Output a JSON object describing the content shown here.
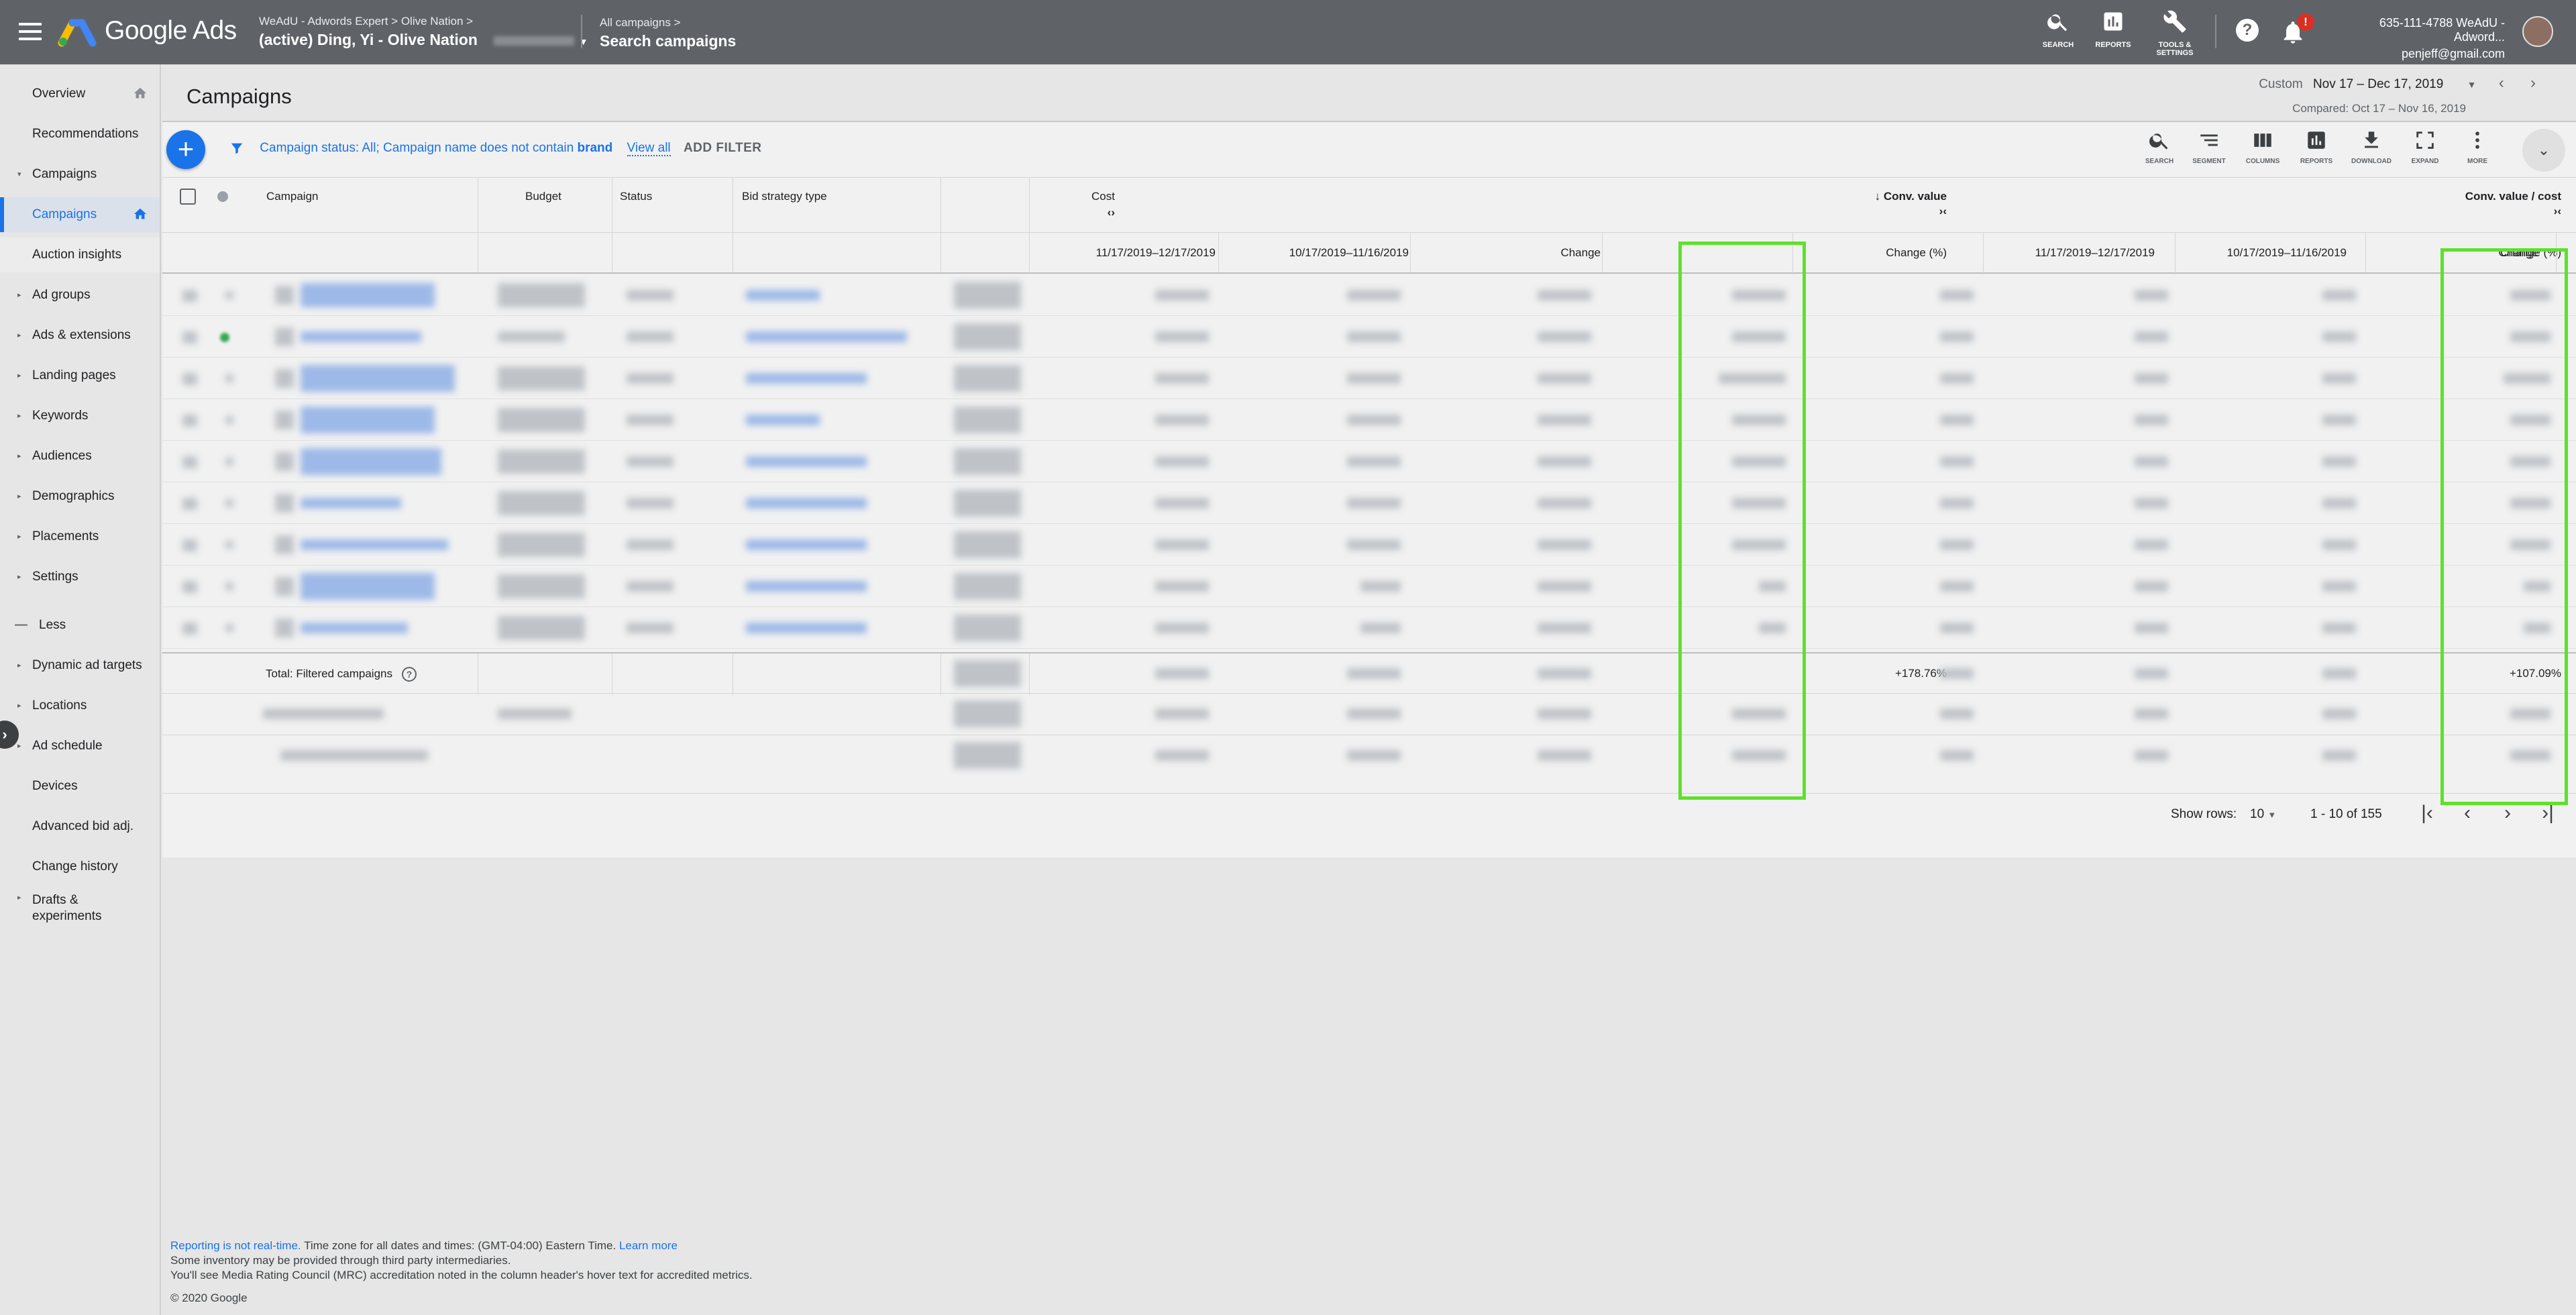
{
  "topbar": {
    "product": "Google Ads",
    "breadcrumb_l1": [
      "WeAdU - Adwords Expert",
      "Olive Nation"
    ],
    "account_name": "(active) Ding, Yi - Olive Nation",
    "campaign_l1": "All campaigns",
    "campaign_l2": "Search campaigns",
    "tools": [
      {
        "label": "SEARCH",
        "icon": "search-icon"
      },
      {
        "label": "REPORTS",
        "icon": "reports-icon"
      },
      {
        "label": "TOOLS & SETTINGS",
        "icon": "wrench-icon"
      }
    ],
    "notification_count": "!",
    "user_line1": "635-111-4788 WeAdU - Adword...",
    "user_line2": "penjeff@gmail.com",
    "help": "?"
  },
  "sidebar": {
    "items": [
      {
        "label": "Overview",
        "arrow": "",
        "home": true
      },
      {
        "label": "Recommendations",
        "arrow": ""
      },
      {
        "label": "Campaigns",
        "arrow": "▾"
      },
      {
        "label": "Campaigns",
        "arrow": "",
        "active": true,
        "home": true
      },
      {
        "label": "Auction insights",
        "arrow": "",
        "sub": true
      },
      {
        "label": "Ad groups",
        "arrow": "▸"
      },
      {
        "label": "Ads & extensions",
        "arrow": "▸"
      },
      {
        "label": "Landing pages",
        "arrow": "▸"
      },
      {
        "label": "Keywords",
        "arrow": "▸"
      },
      {
        "label": "Audiences",
        "arrow": "▸"
      },
      {
        "label": "Demographics",
        "arrow": "▸"
      },
      {
        "label": "Placements",
        "arrow": "▸"
      },
      {
        "label": "Settings",
        "arrow": "▸"
      },
      {
        "label": "Less",
        "arrow": "—"
      },
      {
        "label": "Dynamic ad targets",
        "arrow": "▸"
      },
      {
        "label": "Locations",
        "arrow": "▸"
      },
      {
        "label": "Ad schedule",
        "arrow": "▸"
      },
      {
        "label": "Devices",
        "arrow": ""
      },
      {
        "label": "Advanced bid adj.",
        "arrow": ""
      },
      {
        "label": "Change history",
        "arrow": ""
      },
      {
        "label": "Drafts &",
        "arrow": "▸"
      },
      {
        "label": "experiments",
        "arrow": ""
      }
    ]
  },
  "page": {
    "title": "Campaigns",
    "date_label": "Custom",
    "date_range": "Nov 17 – Dec 17, 2019",
    "compared": "Compared: Oct 17 – Nov 16, 2019"
  },
  "filter": {
    "status_text": "Campaign status: All;",
    "name_text": "Campaign name does not contain",
    "name_value": "brand",
    "view_all": "View all",
    "add_filter": "ADD FILTER"
  },
  "toolbar": [
    {
      "label": "SEARCH",
      "icon": "search-icon"
    },
    {
      "label": "SEGMENT",
      "icon": "segment-icon"
    },
    {
      "label": "COLUMNS",
      "icon": "columns-icon"
    },
    {
      "label": "REPORTS",
      "icon": "reports-icon"
    },
    {
      "label": "DOWNLOAD",
      "icon": "download-icon"
    },
    {
      "label": "EXPAND",
      "icon": "expand-icon"
    },
    {
      "label": "MORE",
      "icon": "more-icon"
    }
  ],
  "table": {
    "headers": {
      "campaign": "Campaign",
      "budget": "Budget",
      "status": "Status",
      "bid_strategy": "Bid strategy type",
      "cost": "Cost",
      "conv_value": "Conv. value",
      "conv_value_cost": "Conv. value / cost"
    },
    "subheaders": [
      "11/17/2019–12/17/2019",
      "10/17/2019–11/16/2019",
      "Change",
      "Change (%)",
      "11/17/2019–12/17/2019",
      "10/17/2019–11/16/2019",
      "Change",
      "Change (%)"
    ],
    "total_label": "Total: Filtered campaigns",
    "total_conv_value_change": "+178.76%",
    "total_conv_value_cost_change": "+107.09%"
  },
  "pager": {
    "show_rows_label": "Show rows:",
    "rows_value": "10",
    "range": "1 - 10 of 155"
  },
  "footer": {
    "reporting": "Reporting is not real-time.",
    "tz": "Time zone for all dates and times: (GMT-04:00) Eastern Time.",
    "learn_more": "Learn more",
    "inventory": "Some inventory may be provided through third party intermediaries.",
    "mrc": "You'll see Media Rating Council (MRC) accreditation noted in the column header's hover text for accredited metrics.",
    "copyright": "© 2020 Google"
  },
  "colors": {
    "highlight": "#5ee12b",
    "accent": "#1a73e8",
    "topbar": "#5f6368"
  }
}
